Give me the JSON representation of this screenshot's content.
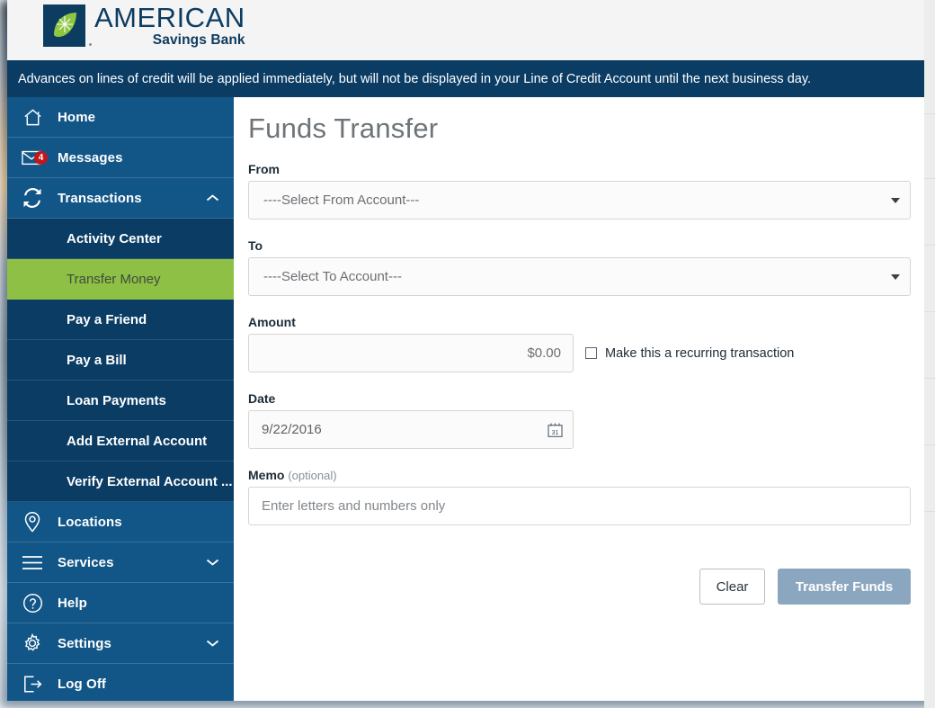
{
  "brand": {
    "name": "AMERICAN",
    "tagline": "Savings Bank",
    "logo_icon": "leaf-starburst-icon",
    "navy": "#0d3c61",
    "green": "#8dc044"
  },
  "banner": {
    "text": "Advances on lines of credit will be applied immediately, but will not be displayed in your Line of Credit Account until the next business day."
  },
  "sidebar": {
    "items": [
      {
        "label": "Home",
        "icon": "home-icon",
        "chevron": "",
        "badge": ""
      },
      {
        "label": "Messages",
        "icon": "envelope-icon",
        "chevron": "",
        "badge": "4"
      },
      {
        "label": "Transactions",
        "icon": "transactions-icon",
        "chevron": "chevron-up-icon",
        "badge": ""
      }
    ],
    "submenu": [
      {
        "label": "Activity Center",
        "active": false
      },
      {
        "label": "Transfer Money",
        "active": true
      },
      {
        "label": "Pay a Friend",
        "active": false
      },
      {
        "label": "Pay a Bill",
        "active": false
      },
      {
        "label": "Loan Payments",
        "active": false
      },
      {
        "label": "Add External Account",
        "active": false
      },
      {
        "label": "Verify External Account ...",
        "active": false
      }
    ],
    "items_bottom": [
      {
        "label": "Locations",
        "icon": "map-pin-icon",
        "chevron": ""
      },
      {
        "label": "Services",
        "icon": "hamburger-icon",
        "chevron": "chevron-down-icon"
      },
      {
        "label": "Help",
        "icon": "question-circle-icon",
        "chevron": ""
      },
      {
        "label": "Settings",
        "icon": "gear-icon",
        "chevron": "chevron-down-icon"
      },
      {
        "label": "Log Off",
        "icon": "logout-icon",
        "chevron": ""
      }
    ]
  },
  "main": {
    "title": "Funds Transfer",
    "from": {
      "label": "From",
      "value": "----Select From Account---",
      "arrow_icon": "caret-down-icon"
    },
    "to": {
      "label": "To",
      "value": "----Select To Account---",
      "arrow_icon": "caret-down-icon"
    },
    "amount": {
      "label": "Amount",
      "value": "$0.00"
    },
    "recurring": {
      "label": "Make this a recurring transaction",
      "checked": false
    },
    "date": {
      "label": "Date",
      "value": "9/22/2016",
      "icon": "calendar-icon",
      "icon_day": "31"
    },
    "memo": {
      "label": "Memo",
      "optional": "(optional)",
      "placeholder": "Enter letters and numbers only"
    },
    "buttons": {
      "clear": "Clear",
      "transfer": "Transfer Funds"
    }
  }
}
